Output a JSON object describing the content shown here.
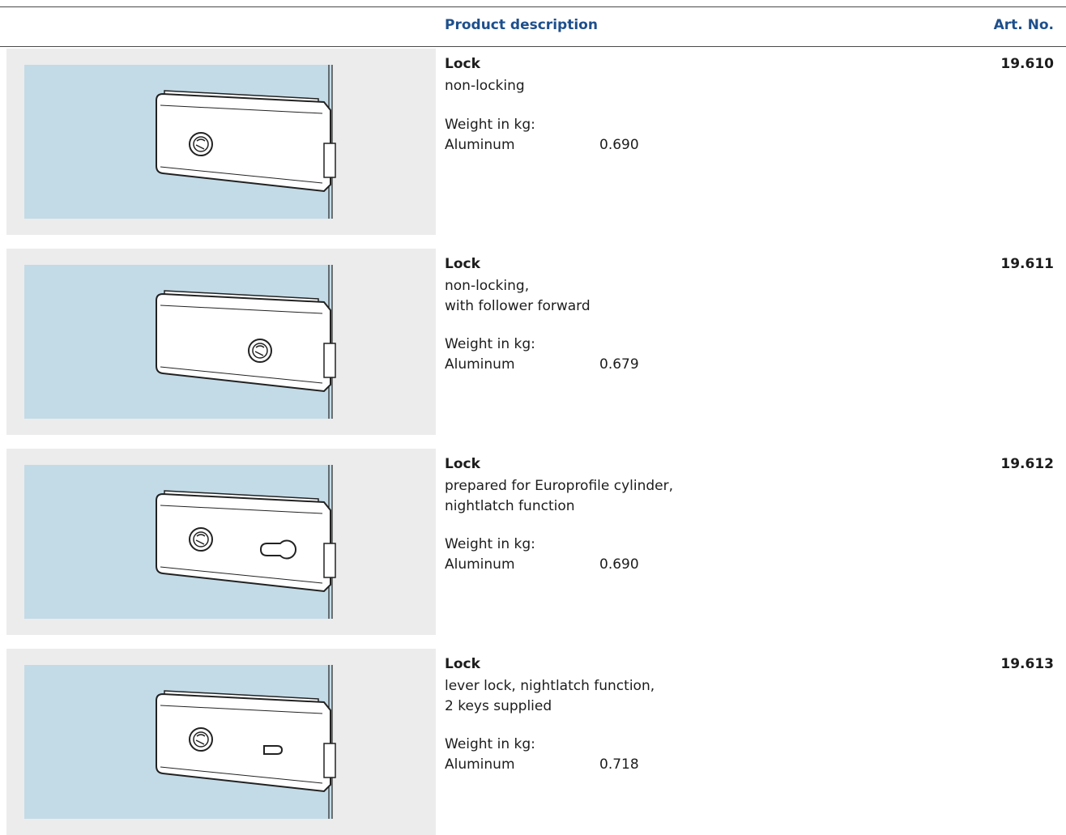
{
  "header": {
    "product_description": "Product description",
    "art_no": "Art. No."
  },
  "colors": {
    "header_text": "#1d4f8c",
    "glass": "#c3dbe7",
    "image_background": "#ececec"
  },
  "products": [
    {
      "title": "Lock",
      "description": [
        "non-locking"
      ],
      "weight_label": "Weight in kg:",
      "material": "Aluminum",
      "weight": "0.690",
      "art_no": "19.610",
      "image": "lock-with-follower-at-left"
    },
    {
      "title": "Lock",
      "description": [
        "non-locking,",
        "with follower forward"
      ],
      "weight_label": "Weight in kg:",
      "material": "Aluminum",
      "weight": "0.679",
      "art_no": "19.611",
      "image": "lock-with-follower-forward"
    },
    {
      "title": "Lock",
      "description": [
        "prepared for Europrofile cylinder,",
        "nightlatch function"
      ],
      "weight_label": "Weight in kg:",
      "material": "Aluminum",
      "weight": "0.690",
      "art_no": "19.612",
      "image": "lock-with-follower-and-euro-cylinder-hole"
    },
    {
      "title": "Lock",
      "description": [
        "lever lock, nightlatch function,",
        "2 keys supplied"
      ],
      "weight_label": "Weight in kg:",
      "material": "Aluminum",
      "weight": "0.718",
      "art_no": "19.613",
      "image": "lock-with-follower-and-lever-keyhole"
    }
  ]
}
